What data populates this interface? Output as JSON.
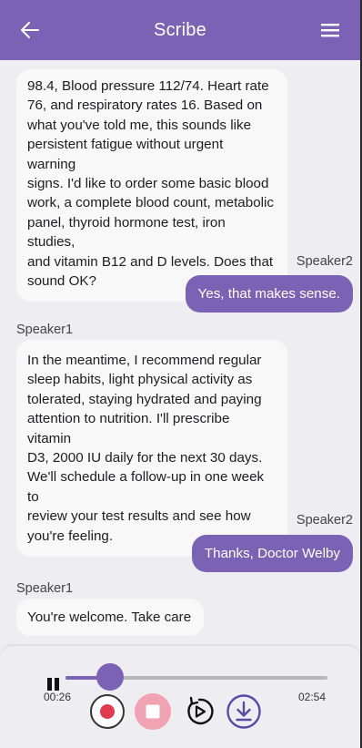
{
  "app": {
    "title": "Scribe"
  },
  "header": {
    "back_icon": "arrow-left-icon",
    "menu_icon": "hamburger-menu-icon"
  },
  "colors": {
    "accent": "#7b62b5",
    "record_red": "#e03a4c",
    "stop_pink": "#f2a3b3",
    "background": "#eeedf1"
  },
  "messages": [
    {
      "side": "left",
      "speaker": "",
      "lines": [
        "98.4, Blood pressure 112/74. Heart rate",
        "76, and respiratory rates 16. Based on",
        "what you've told me, this sounds like",
        "persistent fatigue without urgent warning",
        "signs. I'd like to order some basic blood",
        "work, a complete blood count, metabolic",
        "panel, thyroid hormone test, iron studies,",
        "and vitamin B12 and D levels. Does that",
        "sound OK?"
      ]
    },
    {
      "side": "right",
      "speaker": "Speaker2",
      "lines": [
        "Yes, that makes sense."
      ]
    },
    {
      "side": "left",
      "speaker": "Speaker1",
      "lines": [
        "In the meantime, I recommend regular",
        "sleep habits, light physical activity as",
        "tolerated, staying hydrated and paying",
        "attention to nutrition. I'll prescribe vitamin",
        "D3, 2000 IU daily for the next 30 days.",
        "We'll schedule a follow-up in one week to",
        "review your test results and see how",
        "you're feeling."
      ]
    },
    {
      "side": "right",
      "speaker": "Speaker2",
      "lines": [
        "Thanks, Doctor Welby"
      ]
    },
    {
      "side": "left",
      "speaker": "Speaker1",
      "lines": [
        "You're welcome. Take care"
      ]
    }
  ],
  "player": {
    "current_time": "00:26",
    "total_time": "02:54",
    "progress": 0.17,
    "pause_icon": "pause-icon",
    "record_icon": "record-icon",
    "stop_icon": "stop-icon",
    "replay_icon": "replay-icon",
    "download_icon": "download-icon"
  }
}
